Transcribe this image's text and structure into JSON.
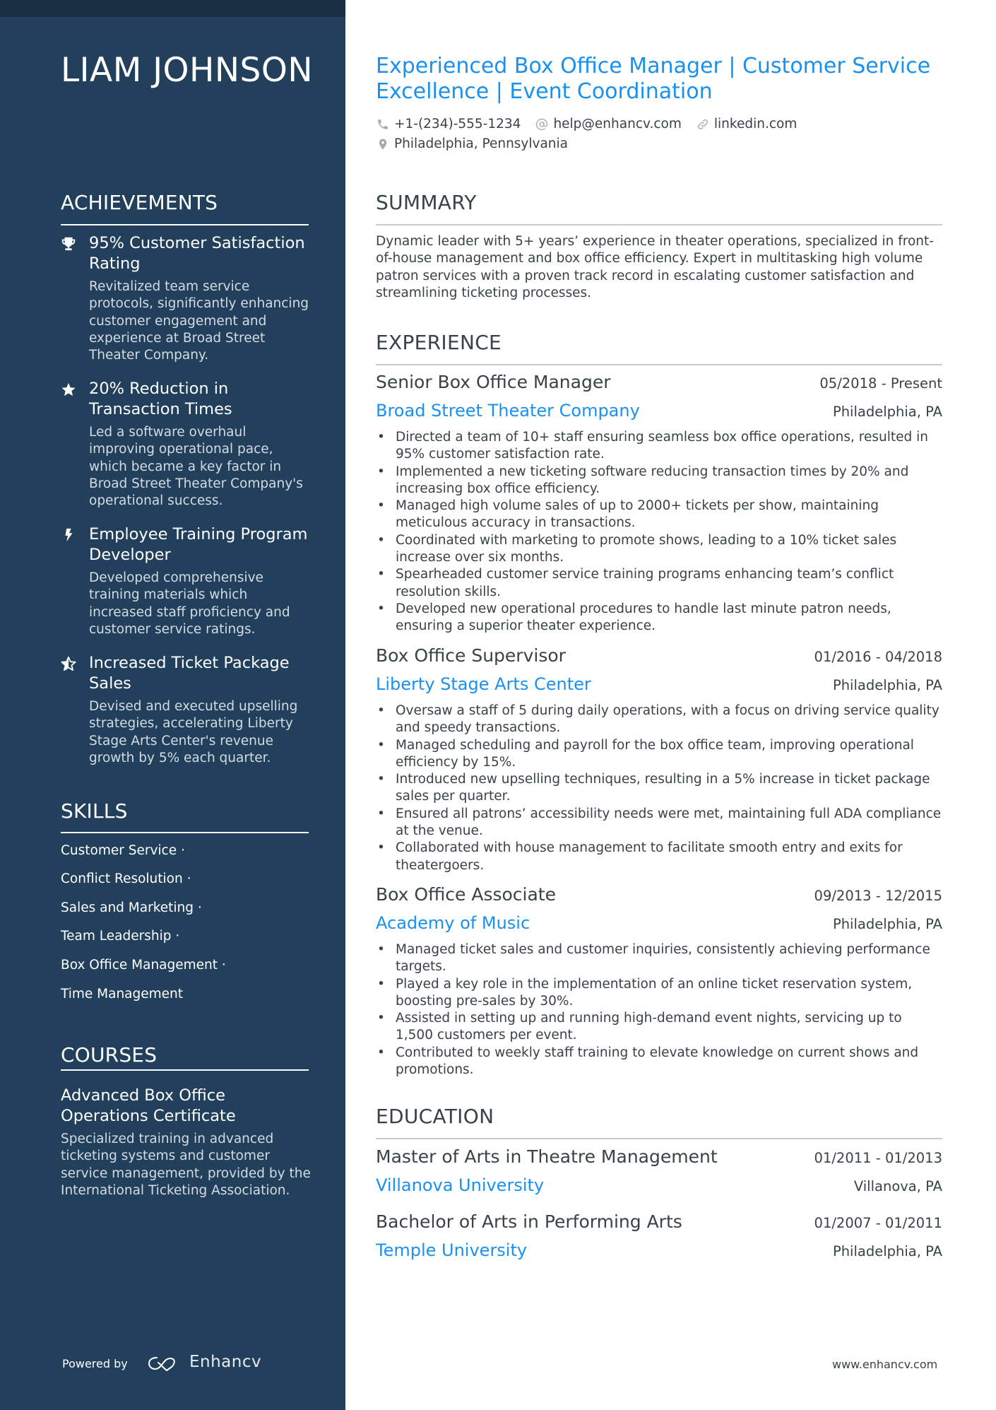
{
  "name": "LIAM JOHNSON",
  "headline": "Experienced Box Office Manager | Customer Service Excellence | Event Coordination",
  "contact": {
    "phone": "+1-(234)-555-1234",
    "email": "help@enhancv.com",
    "website": "linkedin.com",
    "location": "Philadelphia, Pennsylvania"
  },
  "achievements": {
    "title": "ACHIEVEMENTS",
    "items": [
      {
        "icon": "trophy-icon",
        "title": "95% Customer Satisfaction Rating",
        "description": "Revitalized team service protocols, significantly enhancing customer engagement and experience at Broad Street Theater Company."
      },
      {
        "icon": "star-icon",
        "title": "20% Reduction in Transaction Times",
        "description": "Led a software overhaul improving operational pace, which became a key factor in Broad Street Theater Company's operational success."
      },
      {
        "icon": "lightning-icon",
        "title": "Employee Training Program Developer",
        "description": "Developed comprehensive training materials which increased staff proficiency and customer service ratings."
      },
      {
        "icon": "half-star-icon",
        "title": "Increased Ticket Package Sales",
        "description": "Devised and executed upselling strategies, accelerating Liberty Stage Arts Center's revenue growth by 5% each quarter."
      }
    ]
  },
  "skills": {
    "title": "SKILLS",
    "items": [
      "Customer Service ·",
      "Conflict Resolution ·",
      "Sales and Marketing ·",
      "Team Leadership ·",
      "Box Office Management ·",
      "Time Management"
    ]
  },
  "courses": {
    "title": "COURSES",
    "items": [
      {
        "title": "Advanced Box Office Operations Certificate",
        "description": "Specialized training in advanced ticketing systems and customer service management, provided by the International Ticketing Association."
      }
    ]
  },
  "summary": {
    "title": "SUMMARY",
    "text": "Dynamic leader with 5+ years’ experience in theater operations, specialized in front-of-house management and box office efficiency. Expert in multitasking high volume patron services with a proven track record in escalating customer satisfaction and streamlining ticketing processes."
  },
  "experience": {
    "title": "EXPERIENCE",
    "jobs": [
      {
        "role": "Senior Box Office Manager",
        "dates": "05/2018 - Present",
        "company": "Broad Street Theater Company",
        "location": "Philadelphia, PA",
        "bullets": [
          "Directed a team of 10+ staff ensuring seamless box office operations, resulted in 95% customer satisfaction rate.",
          "Implemented a new ticketing software reducing transaction times by 20% and increasing box office efficiency.",
          "Managed high volume sales of up to 2000+ tickets per show, maintaining meticulous accuracy in transactions.",
          "Coordinated with marketing to promote shows, leading to a 10% ticket sales increase over six months.",
          "Spearheaded customer service training programs enhancing team’s conflict resolution skills.",
          "Developed new operational procedures to handle last minute patron needs, ensuring a superior theater experience."
        ]
      },
      {
        "role": "Box Office Supervisor",
        "dates": "01/2016 - 04/2018",
        "company": "Liberty Stage Arts Center",
        "location": "Philadelphia, PA",
        "bullets": [
          "Oversaw a staff of 5 during daily operations, with a focus on driving service quality and speedy transactions.",
          "Managed scheduling and payroll for the box office team, improving operational efficiency by 15%.",
          "Introduced new upselling techniques, resulting in a 5% increase in ticket package sales per quarter.",
          "Ensured all patrons’ accessibility needs were met, maintaining full ADA compliance at the venue.",
          "Collaborated with house management to facilitate smooth entry and exits for theatergoers."
        ]
      },
      {
        "role": "Box Office Associate",
        "dates": "09/2013 - 12/2015",
        "company": "Academy of Music",
        "location": "Philadelphia, PA",
        "bullets": [
          "Managed ticket sales and customer inquiries, consistently achieving performance targets.",
          "Played a key role in the implementation of an online ticket reservation system, boosting pre-sales by 30%.",
          "Assisted in setting up and running high-demand event nights, servicing up to 1,500 customers per event.",
          "Contributed to weekly staff training to elevate knowledge on current shows and promotions."
        ]
      }
    ]
  },
  "education": {
    "title": "EDUCATION",
    "items": [
      {
        "degree": "Master of Arts in Theatre Management",
        "dates": "01/2011 - 01/2013",
        "school": "Villanova University",
        "location": "Villanova, PA"
      },
      {
        "degree": "Bachelor of Arts in Performing Arts",
        "dates": "01/2007 - 01/2011",
        "school": "Temple University",
        "location": "Philadelphia, PA"
      }
    ]
  },
  "footer": {
    "powered_by": "Powered by",
    "brand": "Enhancv",
    "url": "www.enhancv.com"
  },
  "colors": {
    "sidebar": "#22405c",
    "sidebar_top": "#1a2e44",
    "accent": "#1a91f0",
    "text": "#384347"
  }
}
